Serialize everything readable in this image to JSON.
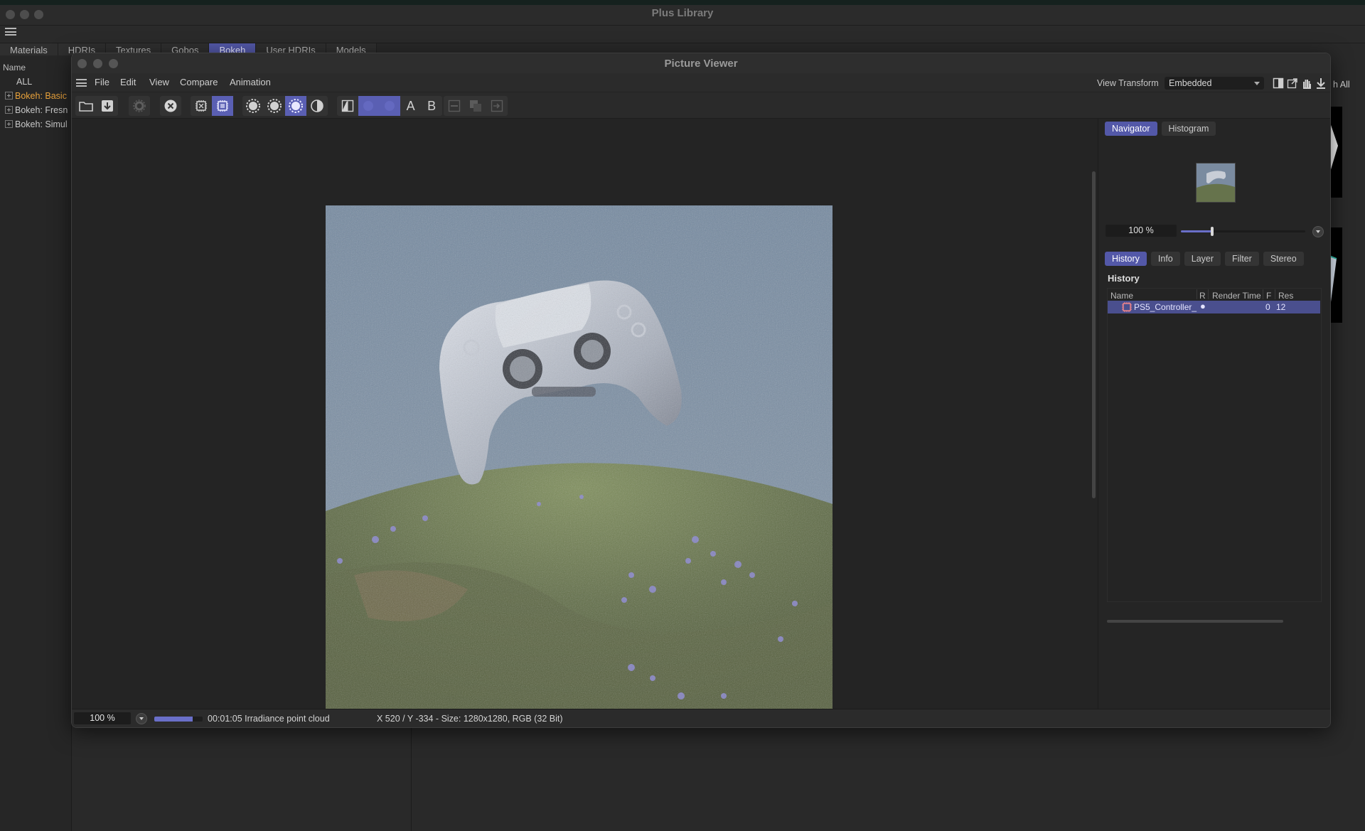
{
  "library": {
    "title": "Plus Library",
    "tabs": [
      "Materials",
      "HDRIs",
      "Textures",
      "Gobos",
      "Bokeh",
      "User HDRIs",
      "Models"
    ],
    "active_tab": "Bokeh",
    "name_header": "Name",
    "tree": [
      {
        "label": "ALL",
        "expandable": false,
        "highlight": false
      },
      {
        "label": "Bokeh: Basic",
        "expandable": true,
        "highlight": true
      },
      {
        "label": "Bokeh: Fresn",
        "expandable": true,
        "highlight": false
      },
      {
        "label": "Bokeh: Simul",
        "expandable": true,
        "highlight": false
      }
    ],
    "search_all_fragment": "h All"
  },
  "viewer": {
    "title": "Picture Viewer",
    "menu": [
      "File",
      "Edit",
      "View",
      "Compare",
      "Animation"
    ],
    "view_transform_label": "View Transform",
    "view_transform_value": "Embedded",
    "toolbar_text": {
      "a": "A",
      "b": "B"
    },
    "right_tabs_top": [
      "Navigator",
      "Histogram"
    ],
    "right_tabs_top_active": "Navigator",
    "nav_zoom": "100 %",
    "nav_zoom_fraction": 0.25,
    "right_tabs": [
      "History",
      "Info",
      "Layer",
      "Filter",
      "Stereo"
    ],
    "right_tabs_active": "History",
    "history_heading": "History",
    "history_columns": [
      "Name",
      "R",
      "Render Time",
      "F",
      "Res"
    ],
    "history_rows": [
      {
        "name": "PS5_Controller_",
        "r": "●",
        "render_time": "",
        "f": "0",
        "res": "12"
      }
    ],
    "status": {
      "zoom": "100 %",
      "progress_fraction": 0.8,
      "text": "00:01:05 Irradiance point cloud",
      "coords": "X 520 / Y -334 - Size: 1280x1280, RGB (32 Bit)"
    },
    "colors": {
      "accent": "#5358a8",
      "highlight_orange": "#e9a23b"
    }
  }
}
